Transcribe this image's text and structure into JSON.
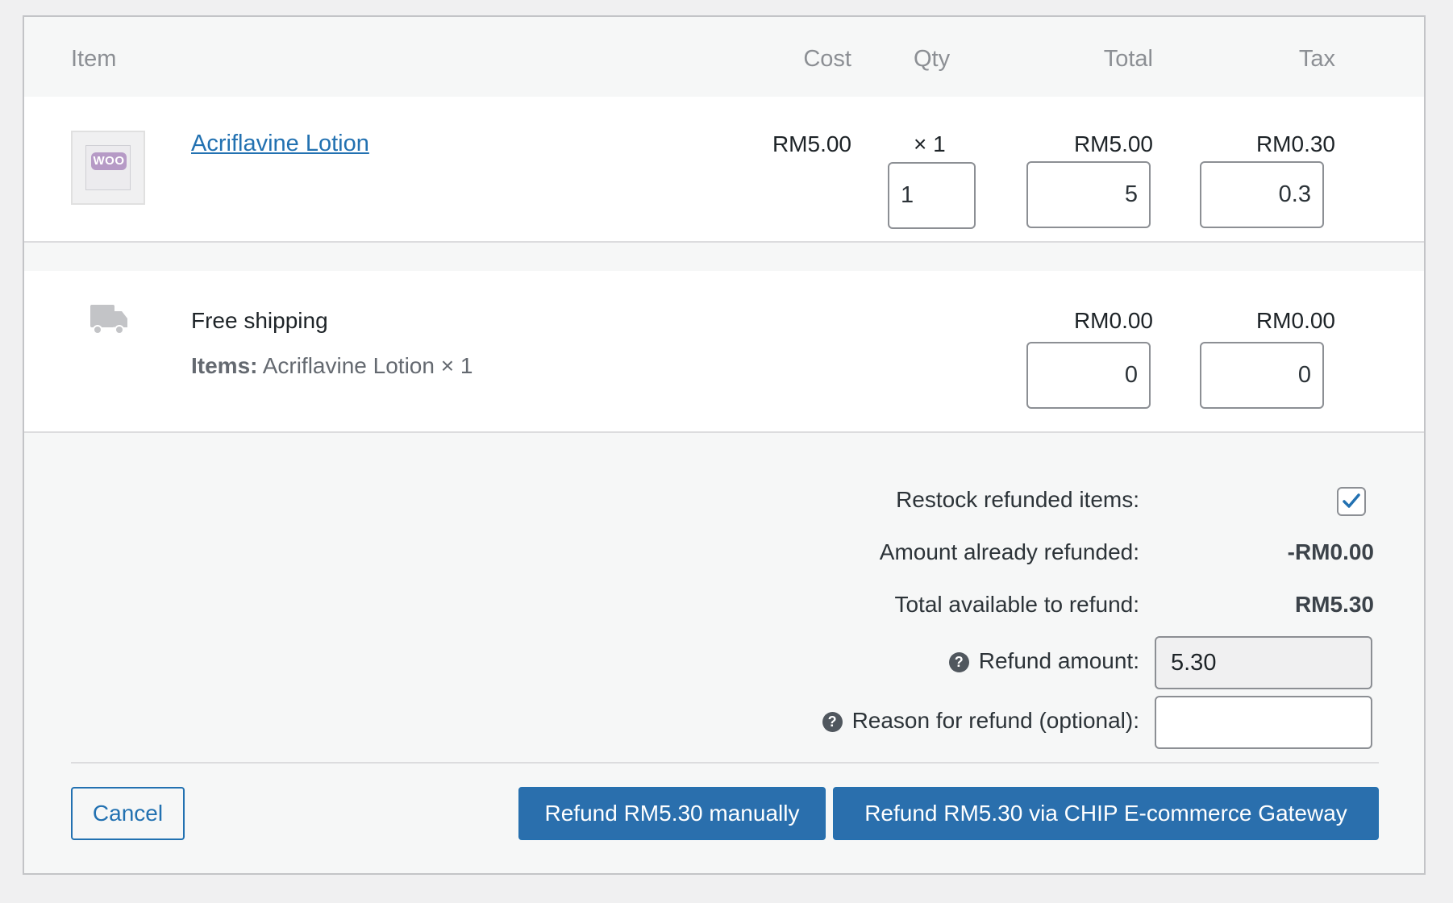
{
  "headers": {
    "item": "Item",
    "cost": "Cost",
    "qty": "Qty",
    "total": "Total",
    "tax": "Tax"
  },
  "line_item": {
    "thumbnail_label": "WOO",
    "name": "Acriflavine Lotion",
    "cost": "RM5.00",
    "qty_label": "× 1",
    "total": "RM5.00",
    "tax": "RM0.30",
    "refund_qty_value": "1",
    "refund_total_value": "5",
    "refund_tax_value": "0.3"
  },
  "shipping": {
    "icon": "truck-icon",
    "method": "Free shipping",
    "items_label": "Items:",
    "items_value": "Acriflavine Lotion × 1",
    "total": "RM0.00",
    "tax": "RM0.00",
    "refund_total_value": "0",
    "refund_tax_value": "0"
  },
  "refund": {
    "restock_label": "Restock refunded items:",
    "restock_checked": true,
    "already_refunded_label": "Amount already refunded:",
    "already_refunded_value": "-RM0.00",
    "available_label": "Total available to refund:",
    "available_value": "RM5.30",
    "amount_label": "Refund amount:",
    "amount_value": "5.30",
    "reason_label": "Reason for refund (optional):",
    "reason_value": ""
  },
  "actions": {
    "cancel_label": "Cancel",
    "refund_manual_label": "Refund RM5.30 manually",
    "refund_gateway_label": "Refund RM5.30 via CHIP E-commerce Gateway"
  },
  "colors": {
    "primary": "#2271b1",
    "link": "#2271b1",
    "muted_text": "#646970"
  }
}
